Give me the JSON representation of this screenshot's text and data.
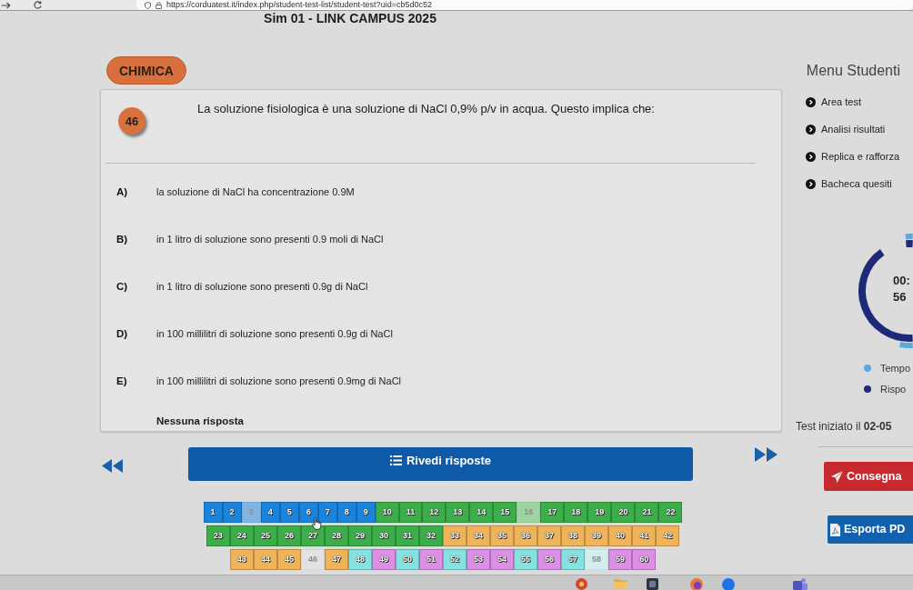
{
  "browser": {
    "url": "https://corduatest.it/index.php/student-test-list/student-test?uid=cb5d0c52"
  },
  "header": {
    "title": "Sim 01 - LINK CAMPUS 2025",
    "subject": "CHIMICA"
  },
  "question": {
    "number": "46",
    "text": "La soluzione fisiologica è una soluzione di NaCl 0,9% p/v in acqua. Questo implica che:",
    "options": [
      {
        "letter": "A)",
        "text": "la soluzione di NaCl ha concentrazione 0.9M"
      },
      {
        "letter": "B)",
        "text": "in 1 litro di soluzione sono presenti 0.9 moli di NaCl"
      },
      {
        "letter": "C)",
        "text": "in 1 litro di soluzione sono presenti 0.9g di NaCl"
      },
      {
        "letter": "D)",
        "text": "in 100 millilitri di soluzione sono presenti 0.9g di NaCl"
      },
      {
        "letter": "E)",
        "text": "in 100 millilitri di soluzione sono presenti 0.9mg di NaCl"
      }
    ],
    "no_answer": "Nessuna risposta"
  },
  "navigation": {
    "review_button": "Rivedi risposte"
  },
  "answer_grid": [
    {
      "label": "1",
      "color": "#1a84dd",
      "faded": false
    },
    {
      "label": "2",
      "color": "#1a84dd",
      "faded": false
    },
    {
      "label": "3",
      "color": "#80b4e2",
      "faded": true
    },
    {
      "label": "4",
      "color": "#1a84dd",
      "faded": false
    },
    {
      "label": "5",
      "color": "#1a84dd",
      "faded": false
    },
    {
      "label": "6",
      "color": "#1a84dd",
      "faded": false
    },
    {
      "label": "7",
      "color": "#1a84dd",
      "faded": false
    },
    {
      "label": "8",
      "color": "#1a84dd",
      "faded": false
    },
    {
      "label": "9",
      "color": "#1a84dd",
      "faded": false
    },
    {
      "label": "10",
      "color": "#3bae49",
      "faded": false
    },
    {
      "label": "11",
      "color": "#3bae49",
      "faded": false
    },
    {
      "label": "12",
      "color": "#3bae49",
      "faded": false
    },
    {
      "label": "13",
      "color": "#3bae49",
      "faded": false
    },
    {
      "label": "14",
      "color": "#3bae49",
      "faded": false
    },
    {
      "label": "15",
      "color": "#3bae49",
      "faded": false
    },
    {
      "label": "16",
      "color": "#9fd3a2",
      "faded": true
    },
    {
      "label": "17",
      "color": "#3bae49",
      "faded": false
    },
    {
      "label": "18",
      "color": "#3bae49",
      "faded": false
    },
    {
      "label": "19",
      "color": "#3bae49",
      "faded": false
    },
    {
      "label": "20",
      "color": "#3bae49",
      "faded": false
    },
    {
      "label": "21",
      "color": "#3bae49",
      "faded": false
    },
    {
      "label": "22",
      "color": "#3bae49",
      "faded": false
    },
    {
      "label": "23",
      "color": "#3bae49",
      "faded": false
    },
    {
      "label": "24",
      "color": "#3bae49",
      "faded": false
    },
    {
      "label": "25",
      "color": "#3bae49",
      "faded": false
    },
    {
      "label": "26",
      "color": "#3bae49",
      "faded": false
    },
    {
      "label": "27",
      "color": "#3bae49",
      "faded": false
    },
    {
      "label": "28",
      "color": "#3bae49",
      "faded": false
    },
    {
      "label": "29",
      "color": "#3bae49",
      "faded": false
    },
    {
      "label": "30",
      "color": "#3bae49",
      "faded": false
    },
    {
      "label": "31",
      "color": "#3bae49",
      "faded": false
    },
    {
      "label": "32",
      "color": "#3bae49",
      "faded": false
    },
    {
      "label": "33",
      "color": "#efb45a",
      "faded": false
    },
    {
      "label": "34",
      "color": "#efb45a",
      "faded": false
    },
    {
      "label": "35",
      "color": "#efb45a",
      "faded": false
    },
    {
      "label": "36",
      "color": "#efb45a",
      "faded": false
    },
    {
      "label": "37",
      "color": "#efb45a",
      "faded": false
    },
    {
      "label": "38",
      "color": "#efb45a",
      "faded": false
    },
    {
      "label": "39",
      "color": "#efb45a",
      "faded": false
    },
    {
      "label": "40",
      "color": "#efb45a",
      "faded": false
    },
    {
      "label": "41",
      "color": "#efb45a",
      "faded": false
    },
    {
      "label": "42",
      "color": "#efb45a",
      "faded": false
    },
    {
      "label": "43",
      "color": "#efb45a",
      "faded": false
    },
    {
      "label": "44",
      "color": "#efb45a",
      "faded": false
    },
    {
      "label": "45",
      "color": "#efb45a",
      "faded": false
    },
    {
      "label": "46",
      "color": "#e2e2e2",
      "faded": true
    },
    {
      "label": "47",
      "color": "#efb45a",
      "faded": false
    },
    {
      "label": "48",
      "color": "#86e2e0",
      "faded": false
    },
    {
      "label": "49",
      "color": "#dd8fe6",
      "faded": false
    },
    {
      "label": "50",
      "color": "#86e2e0",
      "faded": false
    },
    {
      "label": "51",
      "color": "#dd8fe6",
      "faded": false
    },
    {
      "label": "52",
      "color": "#86e2e0",
      "faded": false
    },
    {
      "label": "53",
      "color": "#dd8fe6",
      "faded": false
    },
    {
      "label": "54",
      "color": "#dd8fe6",
      "faded": false
    },
    {
      "label": "55",
      "color": "#86e2e0",
      "faded": false
    },
    {
      "label": "56",
      "color": "#dd8fe6",
      "faded": false
    },
    {
      "label": "57",
      "color": "#86e2e0",
      "faded": false
    },
    {
      "label": "58",
      "color": "#d4eeee",
      "faded": true
    },
    {
      "label": "59",
      "color": "#dd8fe6",
      "faded": false
    },
    {
      "label": "60",
      "color": "#dd8fe6",
      "faded": false
    }
  ],
  "sidebar": {
    "title": "Menu Studenti",
    "items": [
      "Area test",
      "Analisi risultati",
      "Replica e rafforza",
      "Bacheca quesiti"
    ],
    "timer": {
      "time": "00:",
      "answers": "56"
    },
    "legend": [
      {
        "label": "Tempo",
        "color": "#5aa9e0"
      },
      {
        "label": "Rispo",
        "color": "#1e2a78"
      }
    ],
    "started": "Test iniziato il **02-05**",
    "submit_button": "Consegna",
    "export_button": "Esporta PD"
  }
}
